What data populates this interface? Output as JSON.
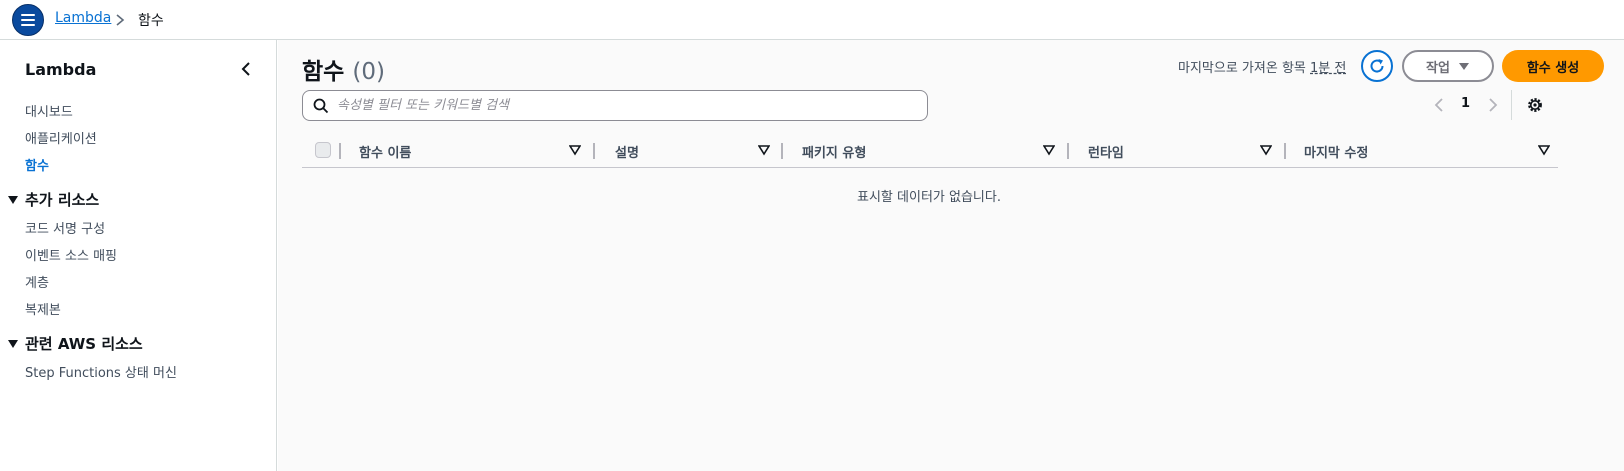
{
  "header": {
    "menu_icon": "hamburger-icon",
    "breadcrumb": [
      "Lambda",
      "함수"
    ]
  },
  "sidebar": {
    "title": "Lambda",
    "items": [
      {
        "label": "대시보드",
        "active": false
      },
      {
        "label": "애플리케이션",
        "active": false
      },
      {
        "label": "함수",
        "active": true
      }
    ],
    "sections": [
      {
        "label": "추가 리소스",
        "expanded": true,
        "items": [
          "코드 서명 구성",
          "이벤트 소스 매핑",
          "계층",
          "복제본"
        ]
      },
      {
        "label": "관련 AWS 리소스",
        "expanded": true,
        "items": [
          "Step Functions 상태 머신"
        ]
      }
    ]
  },
  "main": {
    "title": "함수",
    "count": "(0)",
    "last_fetched_prefix": "마지막으로 가져온 항목",
    "last_fetched_relative": "1분 전",
    "actions_label": "작업",
    "create_label": "함수 생성",
    "search_placeholder": "속성별 필터 또는 키워드별 검색",
    "search_value": "",
    "page_number": "1",
    "columns": [
      "함수 이름",
      "설명",
      "패키지 유형",
      "런타임",
      "마지막 수정"
    ],
    "empty_message": "표시할 데이터가 없습니다."
  },
  "colors": {
    "accent": "#0972d3",
    "primary_button": "#ff9900",
    "menu_button": "#0a4a9e"
  }
}
